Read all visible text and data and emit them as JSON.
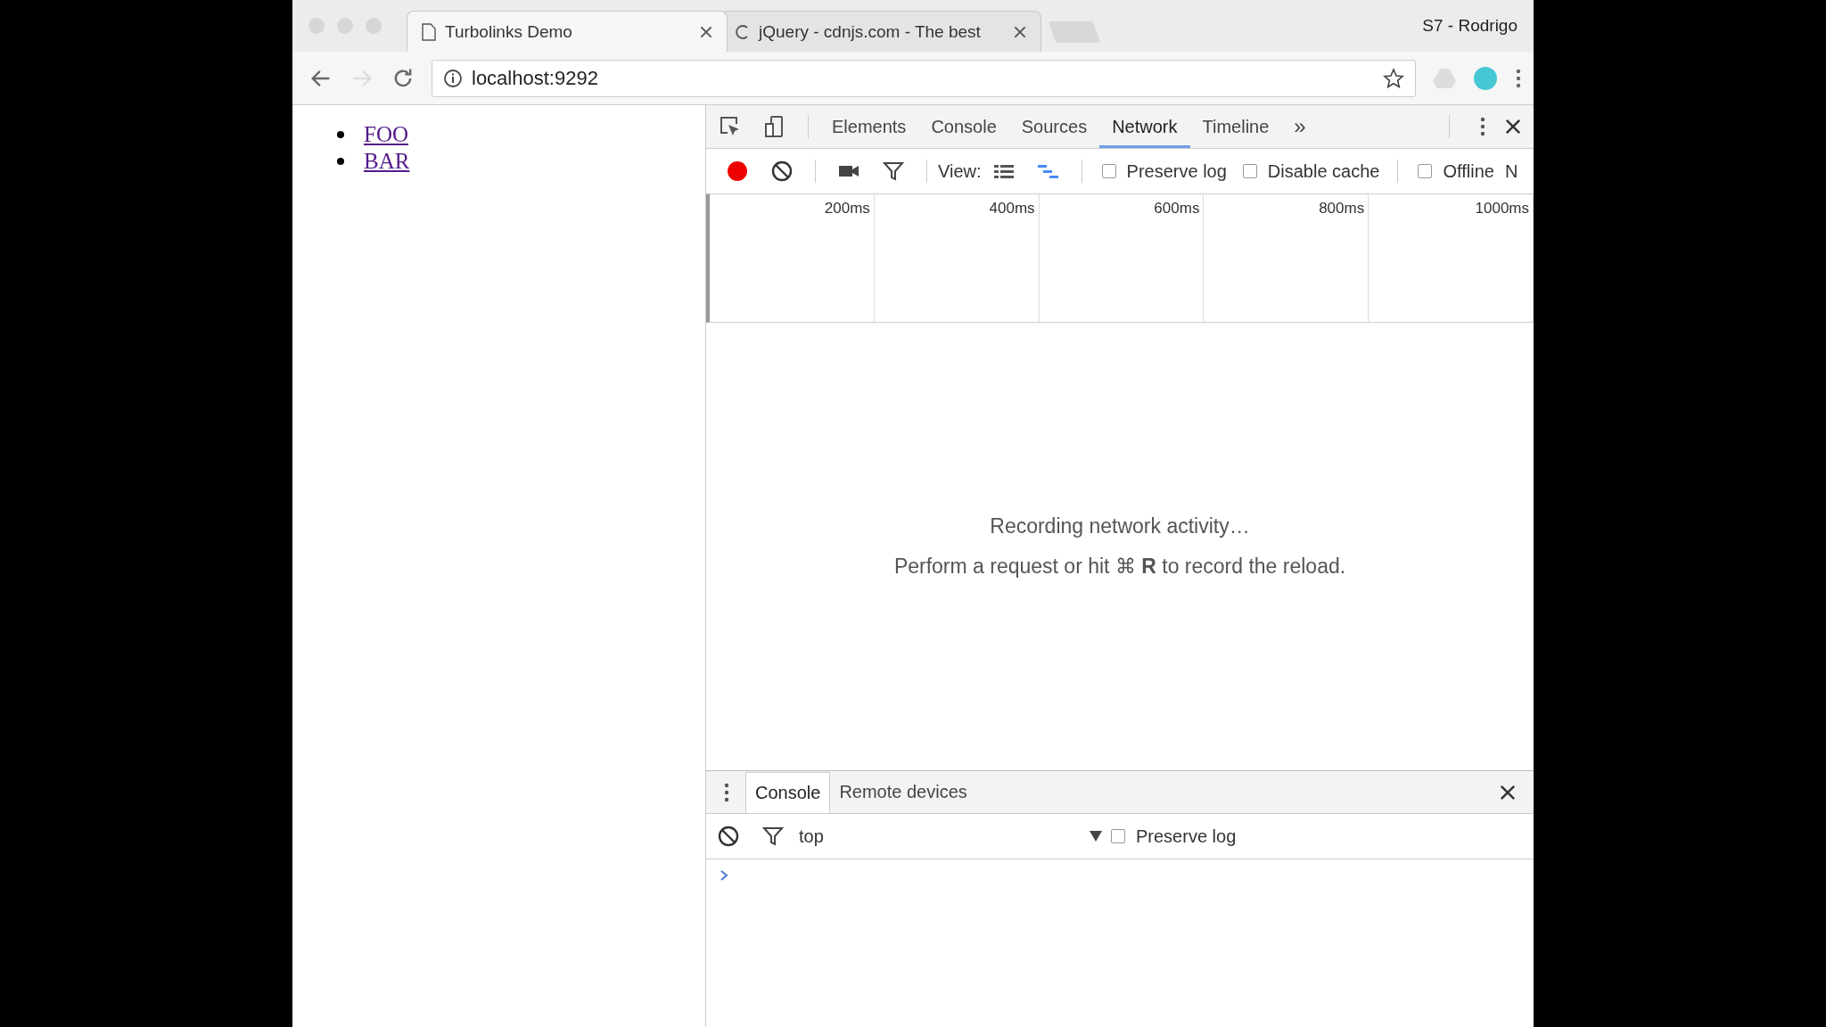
{
  "browser": {
    "tabs": [
      {
        "title": "Turbolinks Demo",
        "kind": "page",
        "selected": true
      },
      {
        "title": "jQuery - cdnjs.com - The best",
        "kind": "loading",
        "selected": false
      }
    ],
    "profile": "S7 - Rodrigo",
    "can_go_forward": false,
    "url": "localhost:9292",
    "bookmarked": false
  },
  "page": {
    "links": [
      "FOO",
      "BAR"
    ]
  },
  "devtools": {
    "tabs": [
      {
        "label": "Elements",
        "selected": false
      },
      {
        "label": "Console",
        "selected": false
      },
      {
        "label": "Sources",
        "selected": false
      },
      {
        "label": "Network",
        "selected": true
      },
      {
        "label": "Timeline",
        "selected": false
      }
    ],
    "more": "»",
    "network": {
      "recording": true,
      "view_label": "View:",
      "views": [
        {
          "kind": "list",
          "selected": false
        },
        {
          "kind": "waterfall",
          "selected": true
        }
      ],
      "options": [
        {
          "label": "Preserve log",
          "checked": false
        },
        {
          "label": "Disable cache",
          "checked": false
        },
        {
          "label": "Offline",
          "checked": false
        }
      ],
      "cut_label": "N",
      "ticks": [
        "200ms",
        "400ms",
        "600ms",
        "800ms",
        "1000ms"
      ],
      "empty_title": "Recording network activity…",
      "empty_hint": "Perform a request or hit ⌘ **R** to record the reload."
    },
    "drawer": {
      "tabs": [
        {
          "label": "Console",
          "selected": true
        },
        {
          "label": "Remote devices",
          "selected": false
        }
      ],
      "context": "top",
      "options": [
        {
          "label": "Preserve log",
          "checked": false
        }
      ]
    }
  }
}
